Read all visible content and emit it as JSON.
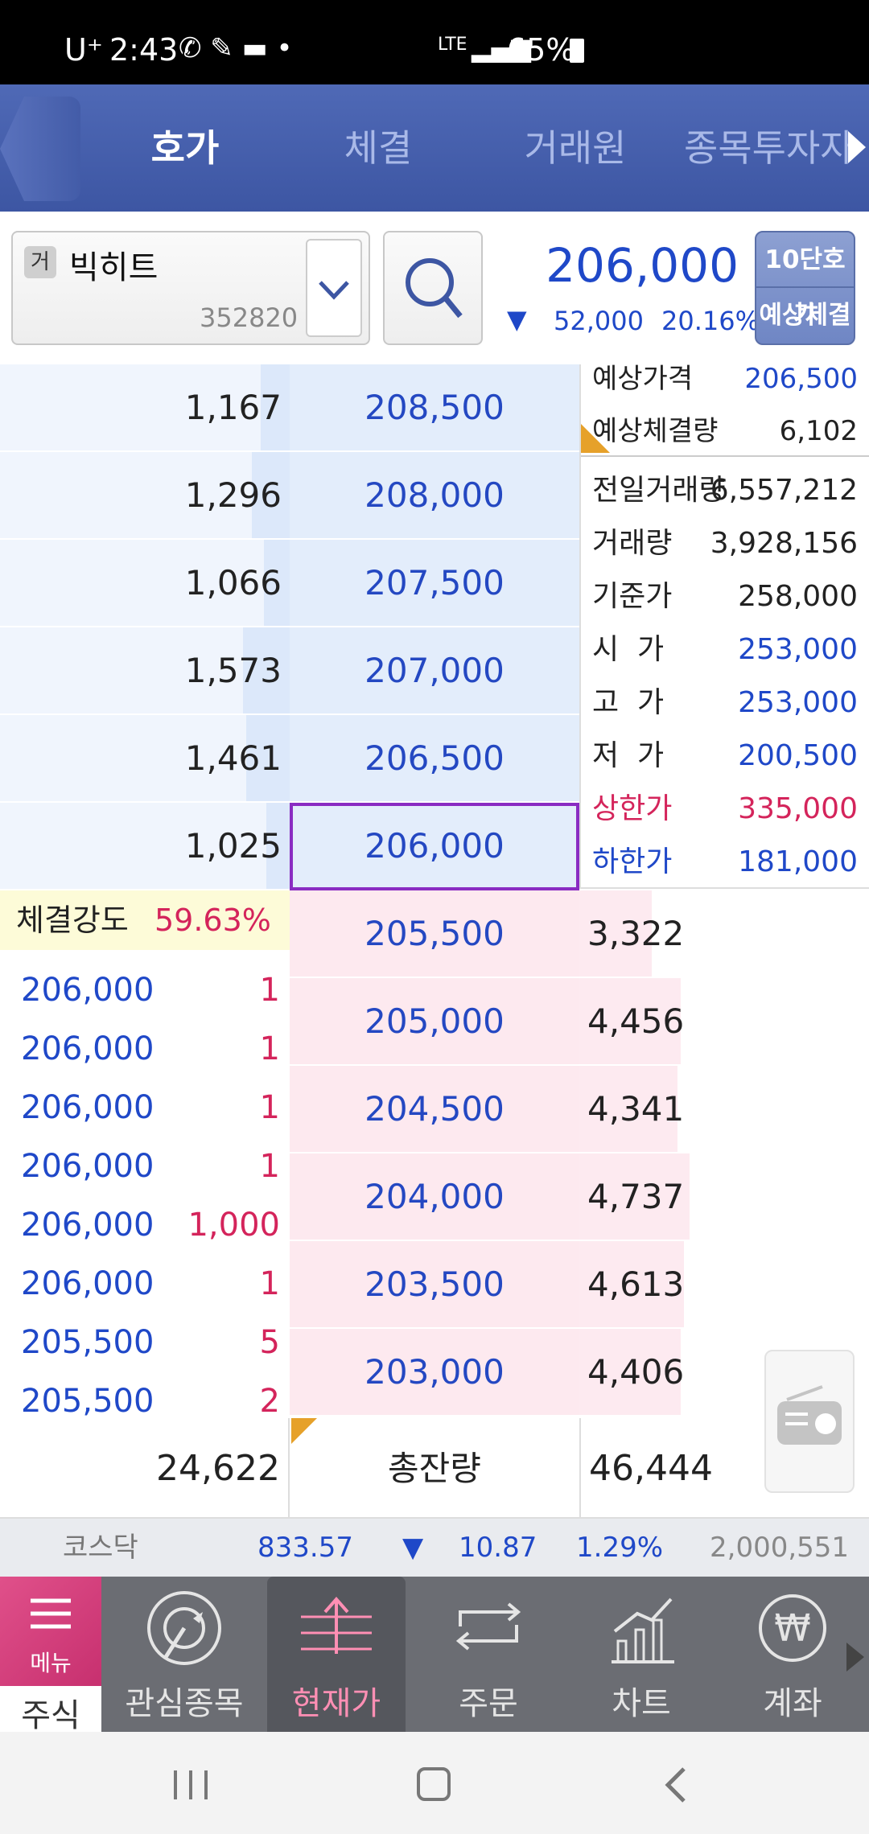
{
  "status_bar": {
    "carrier": "U⁺",
    "time": "2:43",
    "battery": "65%",
    "network": "LTE"
  },
  "tabs": [
    {
      "label": "호가",
      "active": true
    },
    {
      "label": "체결",
      "active": false
    },
    {
      "label": "거래원",
      "active": false
    },
    {
      "label": "종목투자자",
      "active": false
    }
  ],
  "stock": {
    "market_badge": "거",
    "name": "빅히트",
    "code": "352820",
    "price": "206,000",
    "change_direction": "down",
    "change": "52,000",
    "change_pct": "20.16%"
  },
  "level_button": {
    "top": "10단호가",
    "bottom": "예상체결"
  },
  "asks": [
    {
      "qty": "1,167",
      "price": "208,500",
      "ratio": 0.1
    },
    {
      "qty": "1,296",
      "price": "208,000",
      "ratio": 0.13
    },
    {
      "qty": "1,066",
      "price": "207,500",
      "ratio": 0.09
    },
    {
      "qty": "1,573",
      "price": "207,000",
      "ratio": 0.16
    },
    {
      "qty": "1,461",
      "price": "206,500",
      "ratio": 0.15
    },
    {
      "qty": "1,025",
      "price": "206,000",
      "ratio": 0.08
    }
  ],
  "bids": [
    {
      "price": "205,500",
      "qty": "3,322",
      "ratio": 0.25
    },
    {
      "price": "205,000",
      "qty": "4,456",
      "ratio": 0.35
    },
    {
      "price": "204,500",
      "qty": "4,341",
      "ratio": 0.34
    },
    {
      "price": "204,000",
      "qty": "4,737",
      "ratio": 0.38
    },
    {
      "price": "203,500",
      "qty": "4,613",
      "ratio": 0.36
    },
    {
      "price": "203,000",
      "qty": "4,406",
      "ratio": 0.35
    }
  ],
  "expected": [
    {
      "label": "예상가격",
      "value": "206,500"
    },
    {
      "label": "예상체결량",
      "value": "6,102"
    }
  ],
  "info": [
    {
      "label": "전일거래량",
      "value": "6,557,212"
    },
    {
      "label": "거래량",
      "value": "3,928,156"
    },
    {
      "label": "기준가",
      "value": "258,000"
    },
    {
      "label": "시  가",
      "value": "253,000"
    },
    {
      "label": "고  가",
      "value": "253,000"
    },
    {
      "label": "저  가",
      "value": "200,500"
    },
    {
      "label": "상한가",
      "value": "335,000"
    },
    {
      "label": "하한가",
      "value": "181,000"
    }
  ],
  "strength": {
    "label": "체결강도",
    "value": "59.63%"
  },
  "trades": [
    {
      "price": "206,000",
      "qty": "1"
    },
    {
      "price": "206,000",
      "qty": "1"
    },
    {
      "price": "206,000",
      "qty": "1"
    },
    {
      "price": "206,000",
      "qty": "1"
    },
    {
      "price": "206,000",
      "qty": "1,000"
    },
    {
      "price": "206,000",
      "qty": "1"
    },
    {
      "price": "205,500",
      "qty": "5"
    },
    {
      "price": "205,500",
      "qty": "2"
    }
  ],
  "totals": {
    "ask_total": "24,622",
    "label": "총잔량",
    "bid_total": "46,444"
  },
  "index": {
    "name": "코스닥",
    "value": "833.57",
    "change": "10.87",
    "pct": "1.29%",
    "volume": "2,000,551"
  },
  "bottom_nav": {
    "menu_label": "메뉴",
    "section_label": "주식",
    "items": [
      {
        "label": "관심종목",
        "icon": "watchlist-icon"
      },
      {
        "label": "현재가",
        "icon": "current-price-icon",
        "active": true
      },
      {
        "label": "주문",
        "icon": "order-icon"
      },
      {
        "label": "차트",
        "icon": "chart-icon"
      },
      {
        "label": "계좌",
        "icon": "won-icon"
      }
    ]
  },
  "colors": {
    "up": "#d4245b",
    "down": "#1f48c8",
    "accent": "#8a2cc2",
    "header": "#3d56a3"
  }
}
